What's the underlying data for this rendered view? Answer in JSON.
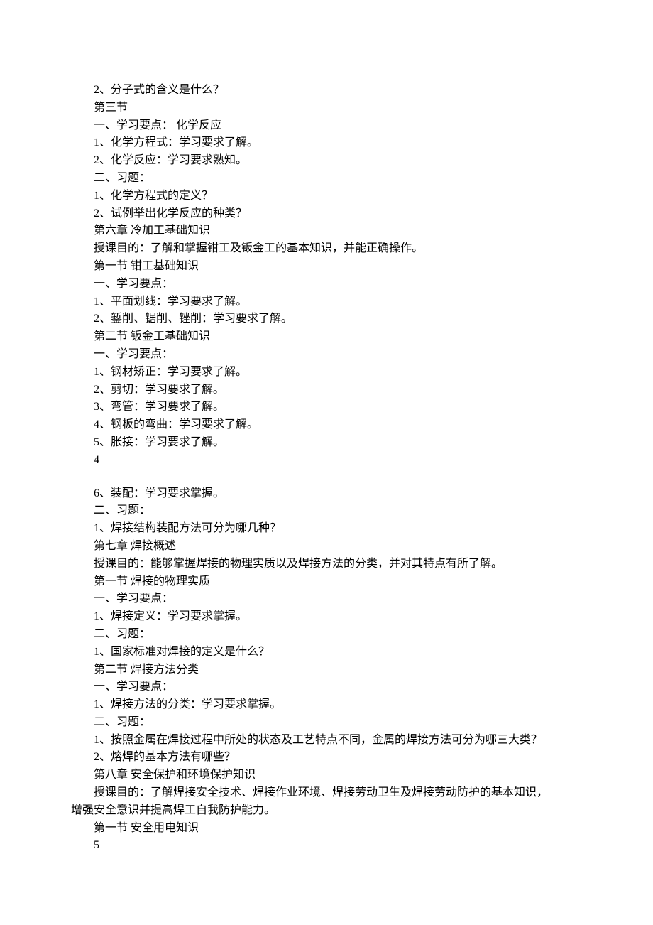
{
  "lines": [
    "2、分子式的含义是什么？",
    "第三节",
    "一、学习要点：  化学反应",
    "1、化学方程式：学习要求了解。",
    "2、化学反应：学习要求熟知。",
    "二、习题：",
    "1、化学方程式的定义？",
    "2、试例举出化学反应的种类？",
    "第六章      冷加工基础知识",
    "授课目的：了解和掌握钳工及钣金工的基本知识，并能正确操作。",
    "第一节      钳工基础知识",
    "一、学习要点：",
    "1、平面划线：学习要求了解。",
    "2、錾削、锯削、锉削：学习要求了解。",
    "第二节      钣金工基础知识",
    "一、学习要点：",
    "1、钢材矫正：学习要求了解。",
    "2、剪切：学习要求了解。",
    "3、弯管：学习要求了解。",
    "4、钢板的弯曲：学习要求了解。",
    "5、胀接：学习要求了解。",
    "4",
    "",
    "6、装配：学习要求掌握。",
    "二、习题：",
    "1、焊接结构装配方法可分为哪几种？",
    "第七章      焊接概述",
    "授课目的：能够掌握焊接的物理实质以及焊接方法的分类，并对其特点有所了解。",
    "第一节      焊接的物理实质",
    "一、学习要点：",
    "1、焊接定义：学习要求掌握。",
    "二、习题：",
    "1、国家标准对焊接的定义是什么？",
    "第二节      焊接方法分类",
    "一、学习要点：",
    "1、焊接方法的分类：学习要求掌握。",
    "二、习题：",
    "1、按照金属在焊接过程中所处的状态及工艺特点不同，金属的焊接方法可分为哪三大类？",
    "2、熔焊的基本方法有哪些？",
    "第八章      安全保护和环境保护知识",
    "授课目的：了解焊接安全技术、焊接作业环境、焊接劳动卫生及焊接劳动防护的基本知识，"
  ],
  "noindent_line": "增强安全意识并提高焊工自我防护能力。",
  "tail_lines": [
    "第一节      安全用电知识",
    "5"
  ]
}
